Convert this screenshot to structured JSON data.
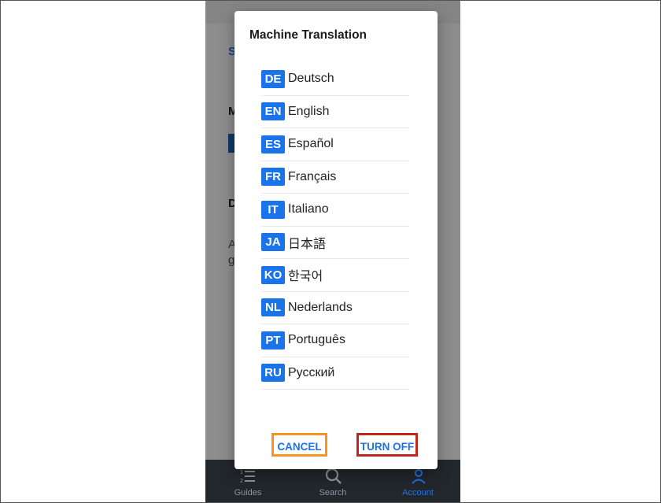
{
  "background": {
    "partial_texts": [
      "S",
      "M",
      "D",
      "A",
      "g"
    ]
  },
  "dialog": {
    "title": "Machine Translation",
    "languages": [
      {
        "code": "DE",
        "name": "Deutsch"
      },
      {
        "code": "EN",
        "name": "English"
      },
      {
        "code": "ES",
        "name": "Español"
      },
      {
        "code": "FR",
        "name": "Français"
      },
      {
        "code": "IT",
        "name": "Italiano"
      },
      {
        "code": "JA",
        "name": "日本語"
      },
      {
        "code": "KO",
        "name": "한국어"
      },
      {
        "code": "NL",
        "name": "Nederlands"
      },
      {
        "code": "PT",
        "name": "Português"
      },
      {
        "code": "RU",
        "name": "Русский"
      }
    ],
    "cancel_label": "CANCEL",
    "turn_off_label": "TURN OFF"
  },
  "navbar": {
    "items": [
      {
        "label": "Guides",
        "icon": "guides-list-icon"
      },
      {
        "label": "Search",
        "icon": "search-icon"
      },
      {
        "label": "Account",
        "icon": "account-icon"
      }
    ],
    "active": "Account"
  },
  "colors": {
    "accent": "#1a73e8",
    "cancel_highlight": "#f7931e",
    "turn_off_highlight": "#c1261a",
    "navbar_bg": "#22272c"
  }
}
